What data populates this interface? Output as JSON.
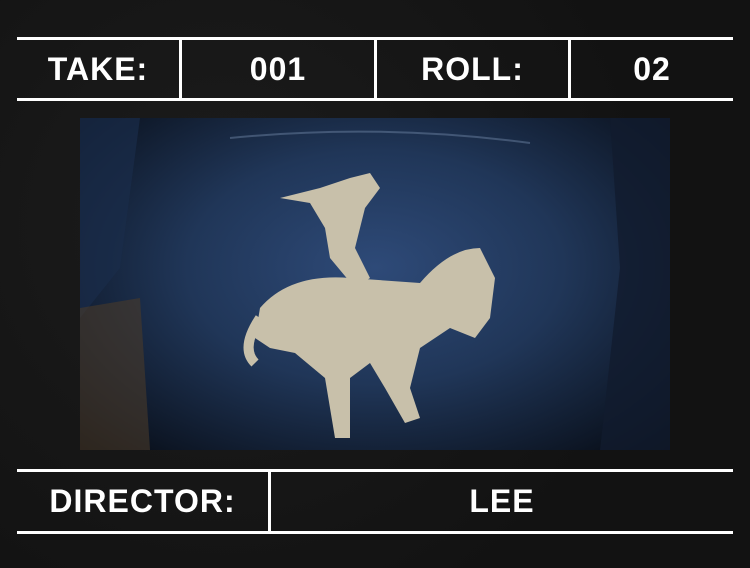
{
  "slate": {
    "take_label": "TAKE:",
    "take_value": "001",
    "roll_label": "ROLL:",
    "roll_value": "02",
    "director_label": "DIRECTOR:",
    "director_value": "LEE"
  },
  "photo": {
    "subject": "denim-jacket-bronco-rider-patch"
  }
}
